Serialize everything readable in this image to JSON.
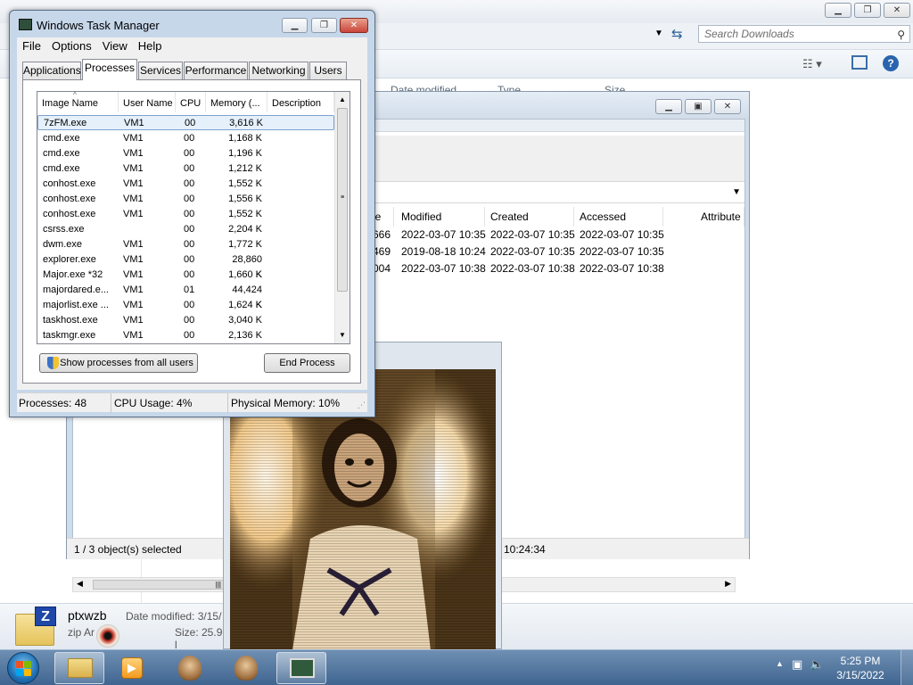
{
  "explorer": {
    "search_placeholder": "Search Downloads",
    "columns": [
      "Date modified",
      "Type",
      "Size"
    ],
    "details": {
      "file_name": "ptxwzb",
      "file_type": "zip Ar",
      "date_label": "Date modified: 3/15/",
      "size_label": "Size: 25.9 l"
    }
  },
  "archive": {
    "columns": [
      "ize",
      "Modified",
      "Created",
      "Accessed",
      "Attribute"
    ],
    "rows": [
      [
        "666",
        "2022-03-07 10:35",
        "2022-03-07 10:35",
        "2022-03-07 10:35"
      ],
      [
        "469",
        "2019-08-18 10:24",
        "2022-03-07 10:35",
        "2022-03-07 10:35"
      ],
      [
        "004",
        "2022-03-07 10:38",
        "2022-03-07 10:38",
        "2022-03-07 10:38"
      ]
    ],
    "status_left": "1 / 3 object(s) selected",
    "status_right": "10:24:34"
  },
  "taskmanager": {
    "title": "Windows Task Manager",
    "menu": [
      "File",
      "Options",
      "View",
      "Help"
    ],
    "tabs": [
      "Applications",
      "Processes",
      "Services",
      "Performance",
      "Networking",
      "Users"
    ],
    "columns": [
      "Image Name",
      "User Name",
      "CPU",
      "Memory (...",
      "Description"
    ],
    "processes": [
      {
        "name": "7zFM.exe",
        "user": "VM1",
        "cpu": "00",
        "mem": "3,616 K"
      },
      {
        "name": "cmd.exe",
        "user": "VM1",
        "cpu": "00",
        "mem": "1,168 K"
      },
      {
        "name": "cmd.exe",
        "user": "VM1",
        "cpu": "00",
        "mem": "1,196 K"
      },
      {
        "name": "cmd.exe",
        "user": "VM1",
        "cpu": "00",
        "mem": "1,212 K"
      },
      {
        "name": "conhost.exe",
        "user": "VM1",
        "cpu": "00",
        "mem": "1,552 K"
      },
      {
        "name": "conhost.exe",
        "user": "VM1",
        "cpu": "00",
        "mem": "1,556 K"
      },
      {
        "name": "conhost.exe",
        "user": "VM1",
        "cpu": "00",
        "mem": "1,552 K"
      },
      {
        "name": "csrss.exe",
        "user": "",
        "cpu": "00",
        "mem": "2,204 K"
      },
      {
        "name": "dwm.exe",
        "user": "VM1",
        "cpu": "00",
        "mem": "1,772 K"
      },
      {
        "name": "explorer.exe",
        "user": "VM1",
        "cpu": "00",
        "mem": "28,860 K"
      },
      {
        "name": "Major.exe *32",
        "user": "VM1",
        "cpu": "00",
        "mem": "1,660 K"
      },
      {
        "name": "majordared.e...",
        "user": "VM1",
        "cpu": "01",
        "mem": "44,424 K"
      },
      {
        "name": "majorlist.exe ...",
        "user": "VM1",
        "cpu": "00",
        "mem": "1,624 K"
      },
      {
        "name": "taskhost.exe",
        "user": "VM1",
        "cpu": "00",
        "mem": "3,040 K"
      },
      {
        "name": "taskmgr.exe",
        "user": "VM1",
        "cpu": "00",
        "mem": "2,136 K"
      }
    ],
    "show_all_label": "Show processes from all users",
    "end_process_label": "End Process",
    "status_processes": "Processes: 48",
    "status_cpu": "CPU Usage: 4%",
    "status_memory": "Physical Memory: 10%"
  },
  "taskbar": {
    "time": "5:25 PM",
    "date": "3/15/2022"
  },
  "colors": {
    "accent": "#3f6590",
    "selection": "#e5f0fb",
    "close_red": "#c9443a"
  }
}
